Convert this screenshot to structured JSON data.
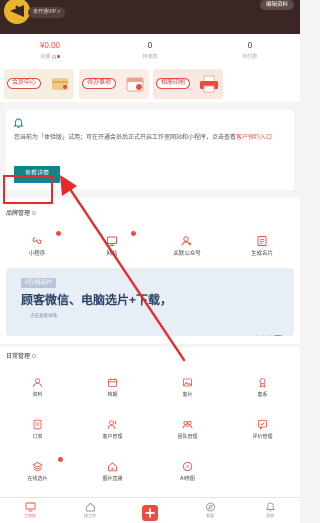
{
  "header": {
    "vip_label": "未开通VIP >",
    "profile_button": "编辑资料"
  },
  "stats": [
    {
      "value": "¥0.00",
      "label": "余额"
    },
    {
      "value": "0",
      "label": "待收款"
    },
    {
      "value": "0",
      "label": "待付款"
    }
  ],
  "feature_cards": [
    {
      "label": "会员中心"
    },
    {
      "label": "待办事项"
    },
    {
      "label": "相册印刷"
    }
  ],
  "notice": {
    "text": "您当前为「体验版」试用；可在开通会员后正式开启工作室网站和小程序，点击查看",
    "link": "客户预约入口",
    "button": "查看详情"
  },
  "brand": {
    "title": "品牌管理",
    "items": [
      {
        "label": "小程序",
        "icon": "mini-program-icon",
        "badge": true
      },
      {
        "label": "网站",
        "icon": "website-icon",
        "badge": true
      },
      {
        "label": "关联公众号",
        "icon": "official-account-icon",
        "badge": false
      },
      {
        "label": "生成名片",
        "icon": "business-card-icon",
        "badge": false
      }
    ],
    "banner": {
      "tag": "#在线选片",
      "title": "顾客微信、电脑选片+下载，",
      "subtitle": "点击查看详情"
    }
  },
  "daily": {
    "title": "日常管理",
    "items": [
      {
        "label": "资料",
        "icon": "profile-icon"
      },
      {
        "label": "档期",
        "icon": "schedule-icon"
      },
      {
        "label": "客片",
        "icon": "client-photos-icon"
      },
      {
        "label": "套系",
        "icon": "package-icon"
      },
      {
        "label": "订单",
        "icon": "order-icon"
      },
      {
        "label": "客户管理",
        "icon": "customer-icon"
      },
      {
        "label": "团队管理",
        "icon": "team-icon"
      },
      {
        "label": "评价管理",
        "icon": "review-icon"
      },
      {
        "label": "在线选片",
        "icon": "online-select-icon"
      },
      {
        "label": "图片直播",
        "icon": "photo-live-icon"
      },
      {
        "label": "AI修图",
        "icon": "ai-retouch-icon"
      }
    ]
  },
  "bottom_nav": [
    {
      "label": "工作台",
      "icon": "workbench-icon",
      "active": true
    },
    {
      "label": "找工作",
      "icon": "home-icon",
      "active": false
    },
    {
      "label": "",
      "icon": "add-icon",
      "active": false
    },
    {
      "label": "发现",
      "icon": "compass-icon",
      "active": false
    },
    {
      "label": "消息",
      "icon": "bell-icon",
      "active": false
    }
  ],
  "colors": {
    "accent": "#e84d3d",
    "header_bg": "#3a2623",
    "teal_button": "#10848a",
    "annotation": "#e32b2b"
  }
}
